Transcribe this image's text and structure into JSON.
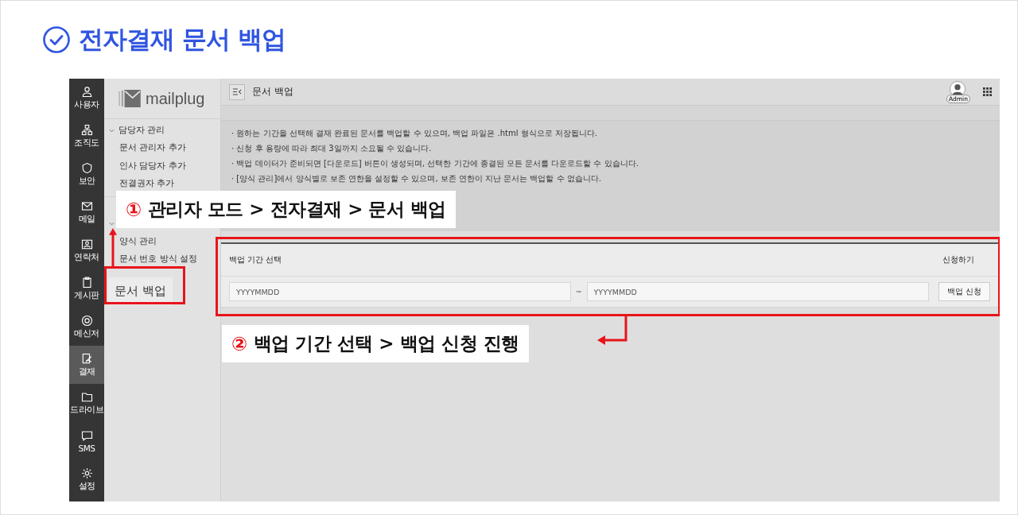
{
  "title": "전자결재 문서 백업",
  "rail": [
    {
      "label": "사용자",
      "selected": false
    },
    {
      "label": "조직도",
      "selected": false
    },
    {
      "label": "보안",
      "selected": false
    },
    {
      "label": "메일",
      "selected": false
    },
    {
      "label": "연락처",
      "selected": false
    },
    {
      "label": "게시판",
      "selected": false
    },
    {
      "label": "메신저",
      "selected": false
    },
    {
      "label": "결재",
      "selected": true
    },
    {
      "label": "드라이브",
      "selected": false
    },
    {
      "label": "SMS",
      "selected": false
    },
    {
      "label": "설정",
      "selected": false
    }
  ],
  "sidebar": {
    "logo": "mailplug",
    "groups": [
      {
        "label": "담당자 관리",
        "expanded": true,
        "items": [
          {
            "label": "문서 관리자 추가",
            "selected": false
          },
          {
            "label": "인사 담당자 추가",
            "selected": false
          },
          {
            "label": "전결권자 추가",
            "selected": false
          }
        ]
      },
      {
        "expanded": true,
        "items": [
          {
            "label": "양식 관리",
            "selected": false
          },
          {
            "label": "문서 번호 방식 설정",
            "selected": false
          },
          {
            "label": "문서 백업",
            "selected": true
          }
        ]
      }
    ]
  },
  "header": {
    "title": "문서 백업",
    "avatar_badge": "Admin"
  },
  "notices": [
    "· 원하는 기간을 선택해 결재 완료된 문서를 백업할 수 있으며, 백업 파일은 .html 형식으로 저장됩니다.",
    "· 신청 후 용량에 따라 최대 3일까지 소요될 수 있습니다.",
    "· 백업 데이터가 준비되면 [다운로드] 버튼이 생성되며, 선택한 기간에 종결된 모든 문서를 다운로드할 수 있습니다.",
    "· [양식 관리]에서 양식별로 보존 연한을 설정할 수 있으며, 보존 연한이 지난 문서는 백업할 수 없습니다."
  ],
  "backup_form": {
    "label": "백업 기간 선택",
    "action_label": "신청하기",
    "start_placeholder": "YYYYMMDD",
    "separator": "~",
    "end_placeholder": "YYYYMMDD",
    "button": "백업 신청"
  },
  "annotations": [
    {
      "number": "①",
      "text": "관리자 모드 > 전자결재 > 문서 백업"
    },
    {
      "number": "②",
      "text": "백업 기간 선택 > 백업 신청 진행"
    }
  ]
}
